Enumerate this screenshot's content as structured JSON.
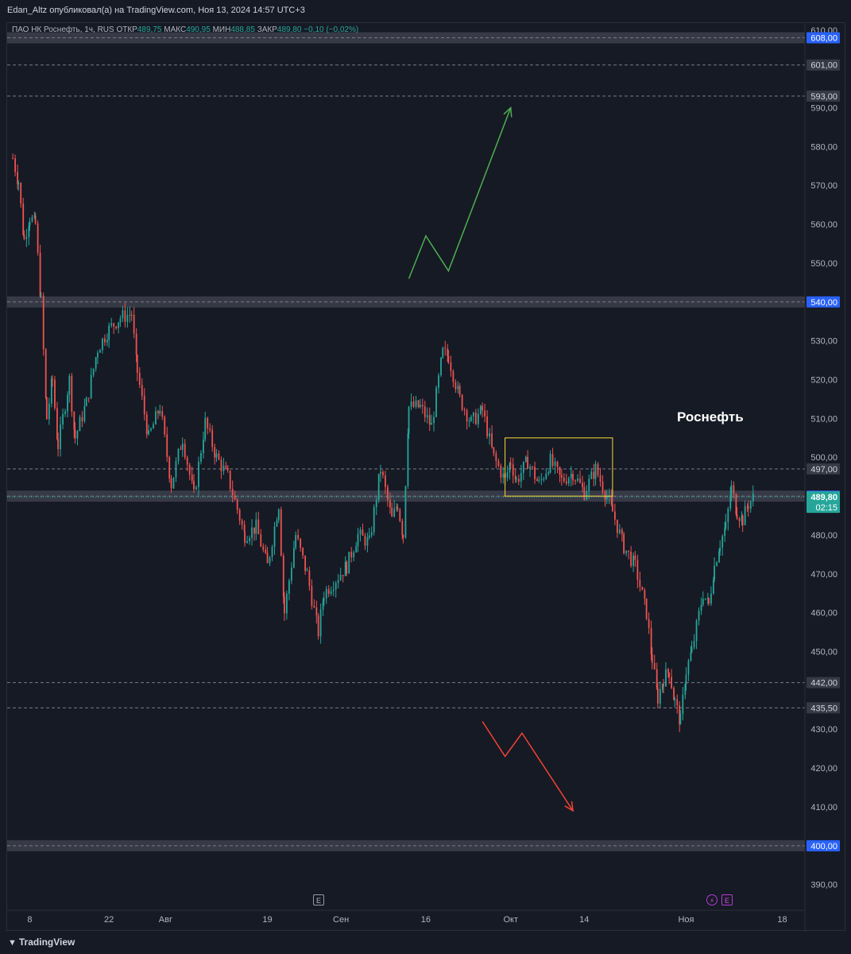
{
  "header": {
    "publisher": "Edan_Altz опубликовал(а) на TradingView.com, Ноя 13, 2024 14:57 UTC+3"
  },
  "symbol_line": {
    "name": "ПАО НК Роснефть, 1ч, RUS",
    "open_label": "ОТКР",
    "open": "489,75",
    "high_label": "МАКС",
    "high": "490,95",
    "low_label": "МИН",
    "low": "488,85",
    "close_label": "ЗАКР",
    "close": "489,80",
    "change": "−0,10 (−0,02%)"
  },
  "annotation": {
    "title": "Роснефть"
  },
  "footer": {
    "brand": "TradingView"
  },
  "badges": {
    "earnings_sep": "E",
    "flash": "⚡",
    "earnings_nov": "E"
  },
  "colors": {
    "background": "#161a25",
    "up": "#26a69a",
    "down": "#ef5350",
    "zone": "#434651",
    "arrow_up": "#4caf50",
    "arrow_down": "#f44336",
    "box": "#fdd835",
    "label_blue": "#2962ff"
  },
  "chart_data": {
    "type": "candlestick",
    "timeframe": "1ч",
    "currency": "RUS",
    "y_axis": {
      "ylim": [
        384,
        612
      ],
      "ticks": [
        "610,00",
        "590,00",
        "580,00",
        "570,00",
        "560,00",
        "550,00",
        "530,00",
        "520,00",
        "510,00",
        "500,00",
        "480,00",
        "470,00",
        "460,00",
        "450,00",
        "430,00",
        "420,00",
        "410,00",
        "390,00"
      ]
    },
    "x_axis": {
      "labels": [
        "8",
        "22",
        "Авг",
        "19",
        "Сен",
        "16",
        "Окт",
        "14",
        "Ноя",
        "18"
      ]
    },
    "price_path": [
      {
        "x": "Jul 05",
        "y": 577
      },
      {
        "x": "Jul 06",
        "y": 571
      },
      {
        "x": "Jul 07",
        "y": 556
      },
      {
        "x": "Jul 08",
        "y": 562
      },
      {
        "x": "Jul 09",
        "y": 560
      },
      {
        "x": "Jul 10",
        "y": 540
      },
      {
        "x": "Jul 11",
        "y": 510
      },
      {
        "x": "Jul 12",
        "y": 520
      },
      {
        "x": "Jul 13",
        "y": 503
      },
      {
        "x": "Jul 15",
        "y": 520
      },
      {
        "x": "Jul 16",
        "y": 505
      },
      {
        "x": "Jul 18",
        "y": 514
      },
      {
        "x": "Jul 20",
        "y": 528
      },
      {
        "x": "Jul 22",
        "y": 533
      },
      {
        "x": "Jul 24",
        "y": 536
      },
      {
        "x": "Jul 26",
        "y": 537
      },
      {
        "x": "Jul 27",
        "y": 522
      },
      {
        "x": "Jul 29",
        "y": 505
      },
      {
        "x": "Jul 31",
        "y": 513
      },
      {
        "x": "Aug 02",
        "y": 493
      },
      {
        "x": "Aug 04",
        "y": 505
      },
      {
        "x": "Aug 06",
        "y": 490
      },
      {
        "x": "Aug 08",
        "y": 509
      },
      {
        "x": "Aug 10",
        "y": 500
      },
      {
        "x": "Aug 12",
        "y": 495
      },
      {
        "x": "Aug 15",
        "y": 480
      },
      {
        "x": "Aug 17",
        "y": 482
      },
      {
        "x": "Aug 19",
        "y": 472
      },
      {
        "x": "Aug 21",
        "y": 488
      },
      {
        "x": "Aug 22",
        "y": 460
      },
      {
        "x": "Aug 24",
        "y": 480
      },
      {
        "x": "Aug 26",
        "y": 470
      },
      {
        "x": "Aug 28",
        "y": 455
      },
      {
        "x": "Aug 29",
        "y": 465
      },
      {
        "x": "Sep 02",
        "y": 472
      },
      {
        "x": "Sep 04",
        "y": 480
      },
      {
        "x": "Sep 06",
        "y": 478
      },
      {
        "x": "Sep 08",
        "y": 497
      },
      {
        "x": "Sep 10",
        "y": 484
      },
      {
        "x": "Sep 11",
        "y": 488
      },
      {
        "x": "Sep 12",
        "y": 480
      },
      {
        "x": "Sep 13",
        "y": 513
      },
      {
        "x": "Sep 15",
        "y": 513
      },
      {
        "x": "Sep 17",
        "y": 508
      },
      {
        "x": "Sep 19",
        "y": 527
      },
      {
        "x": "Sep 20",
        "y": 526
      },
      {
        "x": "Sep 22",
        "y": 515
      },
      {
        "x": "Sep 24",
        "y": 509
      },
      {
        "x": "Sep 26",
        "y": 512
      },
      {
        "x": "Sep 28",
        "y": 500
      },
      {
        "x": "Sep 30",
        "y": 494
      },
      {
        "x": "Oct 01",
        "y": 499
      },
      {
        "x": "Oct 02",
        "y": 494
      },
      {
        "x": "Oct 04",
        "y": 499
      },
      {
        "x": "Oct 06",
        "y": 493
      },
      {
        "x": "Oct 08",
        "y": 499
      },
      {
        "x": "Oct 10",
        "y": 494
      },
      {
        "x": "Oct 12",
        "y": 496
      },
      {
        "x": "Oct 14",
        "y": 491
      },
      {
        "x": "Oct 16",
        "y": 497
      },
      {
        "x": "Oct 18",
        "y": 490
      },
      {
        "x": "Oct 19",
        "y": 486
      },
      {
        "x": "Oct 21",
        "y": 477
      },
      {
        "x": "Oct 23",
        "y": 472
      },
      {
        "x": "Oct 25",
        "y": 460
      },
      {
        "x": "Oct 26",
        "y": 448
      },
      {
        "x": "Oct 27",
        "y": 438
      },
      {
        "x": "Oct 28",
        "y": 443
      },
      {
        "x": "Oct 29",
        "y": 445
      },
      {
        "x": "Oct 30",
        "y": 437
      },
      {
        "x": "Oct 31",
        "y": 432
      },
      {
        "x": "Nov 01",
        "y": 445
      },
      {
        "x": "Nov 02",
        "y": 450
      },
      {
        "x": "Nov 04",
        "y": 465
      },
      {
        "x": "Nov 05",
        "y": 462
      },
      {
        "x": "Nov 06",
        "y": 472
      },
      {
        "x": "Nov 07",
        "y": 478
      },
      {
        "x": "Nov 08",
        "y": 482
      },
      {
        "x": "Nov 09",
        "y": 492
      },
      {
        "x": "Nov 10",
        "y": 486
      },
      {
        "x": "Nov 11",
        "y": 484
      },
      {
        "x": "Nov 12",
        "y": 488
      },
      {
        "x": "Nov 13",
        "y": 489.8
      }
    ],
    "levels": [
      {
        "price": 608,
        "label": "608,00",
        "zone": true
      },
      {
        "price": 601,
        "label": "601,00"
      },
      {
        "price": 593,
        "label": "593,00"
      },
      {
        "price": 540,
        "label": "540,00",
        "zone": true
      },
      {
        "price": 497,
        "label": "497,00"
      },
      {
        "price": 490,
        "label": "490,00",
        "zone": true
      },
      {
        "price": 442,
        "label": "442,00"
      },
      {
        "price": 435.5,
        "label": "435,50"
      },
      {
        "price": 400,
        "label": "400,00",
        "zone": true
      }
    ],
    "last_price": {
      "value": 489.8,
      "label": "489,80",
      "countdown": "02:15"
    },
    "consolidation_box": {
      "x0": "Sep 30",
      "x1": "Oct 19",
      "y0": 490,
      "y1": 505
    },
    "scenarios": [
      {
        "direction": "up",
        "points": [
          {
            "x": "Sep 13",
            "y": 546
          },
          {
            "x": "Sep 16",
            "y": 557
          },
          {
            "x": "Sep 20",
            "y": 548
          },
          {
            "x": "Oct 01",
            "y": 590
          }
        ]
      },
      {
        "direction": "down",
        "points": [
          {
            "x": "Sep 26",
            "y": 432
          },
          {
            "x": "Sep 30",
            "y": 423
          },
          {
            "x": "Oct 03",
            "y": 429
          },
          {
            "x": "Oct 12",
            "y": 409
          }
        ]
      }
    ]
  }
}
